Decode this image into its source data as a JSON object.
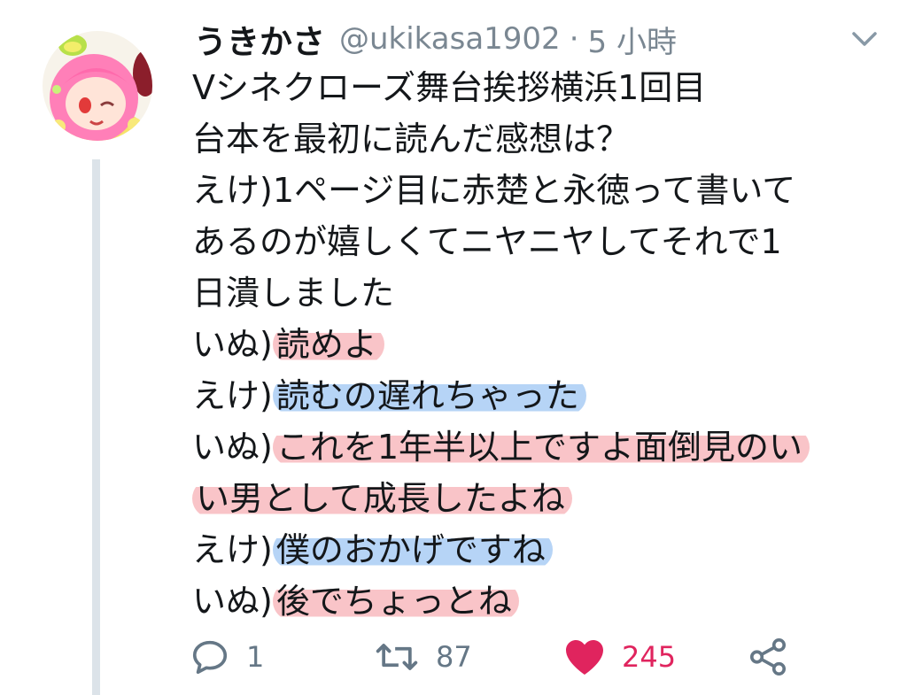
{
  "tweet": {
    "author": {
      "display_name": "うきかさ",
      "handle": "@ukikasa1902"
    },
    "separator": "·",
    "time": "5 小時",
    "lines": [
      {
        "speaker": "",
        "text": "Vシネクローズ舞台挨拶横浜1回目",
        "highlight": "none"
      },
      {
        "speaker": "",
        "text": "台本を最初に読んだ感想は？",
        "highlight": "none"
      },
      {
        "speaker": "えけ)",
        "text": "1ページ目に赤楚と永徳って書いて",
        "highlight": "none"
      },
      {
        "speaker": "",
        "text": "あるのが嬉しくてニヤニヤしてそれで1",
        "highlight": "none"
      },
      {
        "speaker": "",
        "text": "日潰しました",
        "highlight": "none"
      },
      {
        "speaker": "いぬ)",
        "text": "読めよ",
        "highlight": "red"
      },
      {
        "speaker": "えけ)",
        "text": "読むの遅れちゃった",
        "highlight": "blue"
      },
      {
        "speaker": "いぬ)",
        "text": "これを1年半以上ですよ面倒見のい",
        "highlight": "red"
      },
      {
        "speaker": "",
        "text": "い男として成長したよね",
        "highlight": "red"
      },
      {
        "speaker": "えけ)",
        "text": "僕のおかげですね",
        "highlight": "blue"
      },
      {
        "speaker": "いぬ)",
        "text": "後でちょっとね",
        "highlight": "red"
      }
    ],
    "actions": {
      "reply": {
        "icon": "reply-icon",
        "count": "1"
      },
      "retweet": {
        "icon": "retweet-icon",
        "count": "87"
      },
      "like": {
        "icon": "heart-icon",
        "count": "245",
        "color": "#e0245e"
      },
      "share": {
        "icon": "share-icon"
      }
    }
  },
  "colors": {
    "highlight_red": "#f4949a",
    "highlight_blue": "#7ab0ee",
    "thread_line": "#dce3e9",
    "secondary_text": "#657786",
    "like": "#e0245e"
  }
}
